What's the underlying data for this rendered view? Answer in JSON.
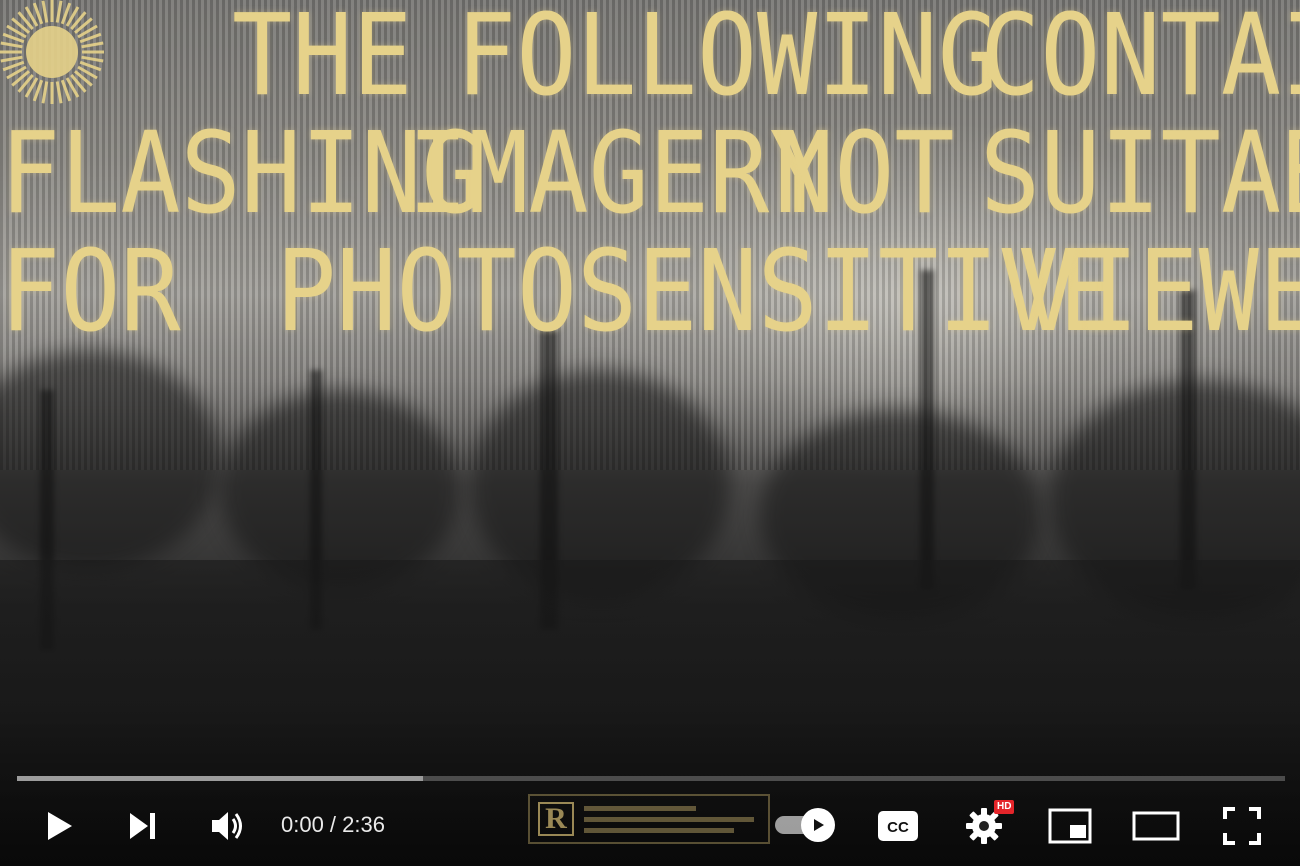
{
  "video": {
    "warning_lines": [
      [
        "THE",
        "FOLLOWING",
        "CONTAINS"
      ],
      [
        "FLASHING",
        "IMAGERY",
        "NOT",
        "SUITABLE"
      ],
      [
        "FOR",
        "PHOTOSENSITIVE",
        "VIEWERS"
      ]
    ],
    "warning_text_color": "#e6d28a",
    "rating_badge_letter": "R"
  },
  "player": {
    "current_time": "0:00",
    "duration": "2:36",
    "time_display": "0:00 / 2:36",
    "buffered_fraction": 0.32,
    "played_fraction": 0.0,
    "autoplay_on": true,
    "quality_badge": "HD",
    "icons": {
      "play": "play-icon",
      "next": "next-icon",
      "volume": "volume-icon",
      "autoplay": "autoplay-toggle-icon",
      "captions": "closed-captions-icon",
      "settings": "settings-gear-icon",
      "miniplayer": "miniplayer-icon",
      "theater": "theater-mode-icon",
      "fullscreen": "fullscreen-icon"
    },
    "colors": {
      "controls": "#ffffff",
      "hd_badge": "#e4252a",
      "progress_track": "#ffffff"
    }
  }
}
